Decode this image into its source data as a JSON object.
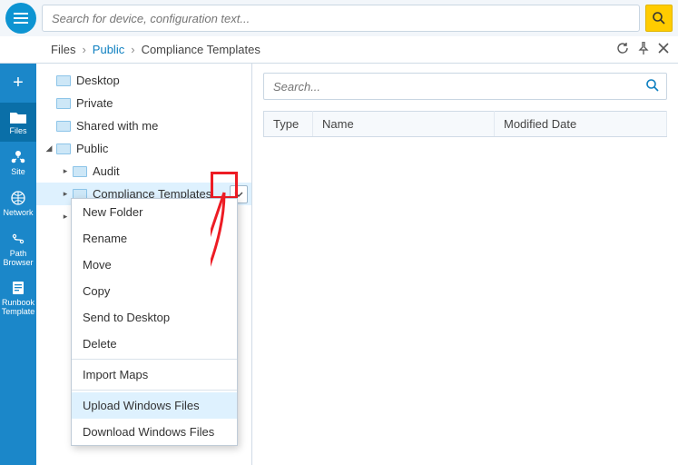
{
  "header": {
    "search_placeholder": "Search for device, configuration text..."
  },
  "breadcrumb": {
    "root": "Files",
    "mid": "Public",
    "leaf": "Compliance Templates"
  },
  "navrail": {
    "files": "Files",
    "site": "Site",
    "network": "Network",
    "path": "Path Browser",
    "runbook": "Runbook Template"
  },
  "tree": {
    "desktop": "Desktop",
    "private": "Private",
    "shared": "Shared with me",
    "public": "Public",
    "audit": "Audit",
    "compliance": "Compliance Templates",
    "blank": ""
  },
  "context_menu": {
    "new_folder": "New Folder",
    "rename": "Rename",
    "move": "Move",
    "copy": "Copy",
    "send_desktop": "Send to Desktop",
    "delete": "Delete",
    "import_maps": "Import Maps",
    "upload_windows": "Upload Windows Files",
    "download_windows": "Download Windows Files"
  },
  "content": {
    "search_placeholder": "Search...",
    "col_type": "Type",
    "col_name": "Name",
    "col_modified": "Modified Date"
  },
  "highlight_colors": {
    "red": "#ed1c24"
  }
}
